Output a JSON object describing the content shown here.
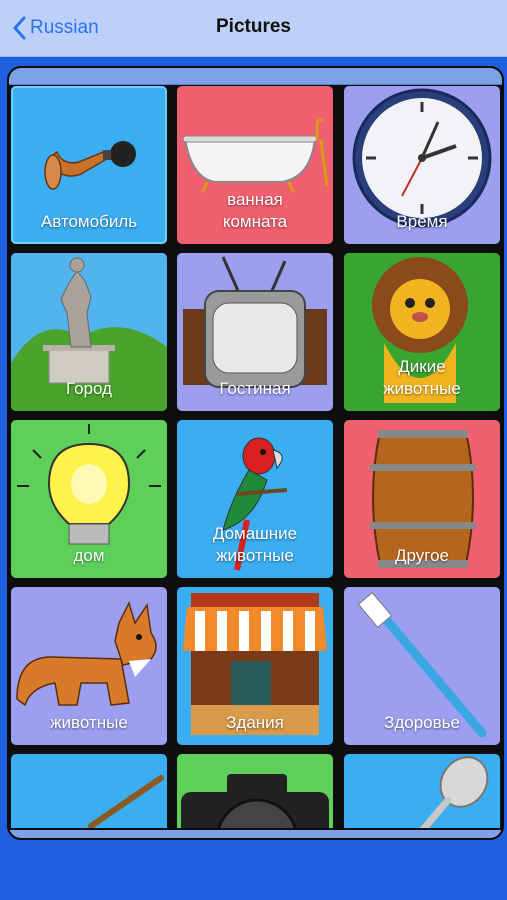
{
  "nav": {
    "back_label": "Russian",
    "title": "Pictures"
  },
  "colors": {
    "background": "#1f5fe0",
    "navbar": "#bcd0f8",
    "accent": "#2b73f0",
    "tile_blue": "#3aaef0",
    "tile_red": "#f0606e",
    "tile_purple": "#9c9ef0",
    "tile_green": "#5ed05a"
  },
  "tiles": [
    {
      "label": "Автомобиль",
      "icon": "horn-icon",
      "color": "#3aaef0"
    },
    {
      "label1": "ванная",
      "label2": "комната",
      "icon": "bathtub-icon",
      "color": "#f0606e"
    },
    {
      "label": "Время",
      "icon": "clock-icon",
      "color": "#9c9ef0"
    },
    {
      "label": "Город",
      "icon": "statue-icon",
      "color": "#3aaef0"
    },
    {
      "label": "Гостиная",
      "icon": "tv-icon",
      "color": "#9c9ef0"
    },
    {
      "label1": "Дикие",
      "label2": "животные",
      "icon": "lion-icon",
      "color": "#5ed05a"
    },
    {
      "label": "дом",
      "icon": "lightbulb-icon",
      "color": "#5ed05a"
    },
    {
      "label1": "Домашние",
      "label2": "животные",
      "icon": "parrot-icon",
      "color": "#3aaef0"
    },
    {
      "label": "Другое",
      "icon": "barrel-icon",
      "color": "#f0606e"
    },
    {
      "label": "животные",
      "icon": "fox-icon",
      "color": "#9c9ef0"
    },
    {
      "label": "Здания",
      "icon": "shop-icon",
      "color": "#3aaef0"
    },
    {
      "label": "Здоровье",
      "icon": "toothbrush-icon",
      "color": "#9c9ef0"
    },
    {
      "icon": "stick-icon",
      "color": "#3aaef0"
    },
    {
      "icon": "camera-icon",
      "color": "#5ed05a"
    },
    {
      "icon": "spoon-icon",
      "color": "#3aaef0"
    }
  ]
}
